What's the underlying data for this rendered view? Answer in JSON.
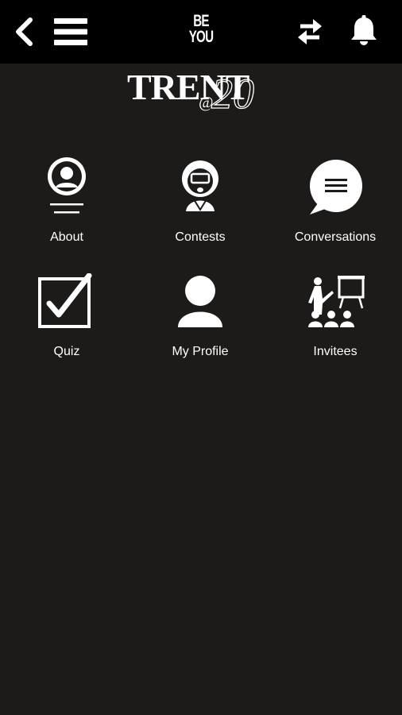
{
  "header": {
    "brand_line1": "BE",
    "brand_line2": "YOU",
    "icons": [
      "back-icon",
      "menu-icon",
      "sync-icon",
      "bell-icon"
    ]
  },
  "logo": {
    "word": "TRENT",
    "at": "@",
    "number": "20"
  },
  "menu": {
    "items": [
      {
        "label": "About",
        "icon": "about-icon"
      },
      {
        "label": "Contests",
        "icon": "contests-icon"
      },
      {
        "label": "Conversations",
        "icon": "conversations-icon"
      },
      {
        "label": "Quiz",
        "icon": "quiz-icon"
      },
      {
        "label": "My Profile",
        "icon": "profile-icon"
      },
      {
        "label": "Invitees",
        "icon": "invitees-icon"
      }
    ]
  },
  "colors": {
    "topbar": "#000000",
    "background": "#1d1b19",
    "foreground": "#ffffff"
  }
}
